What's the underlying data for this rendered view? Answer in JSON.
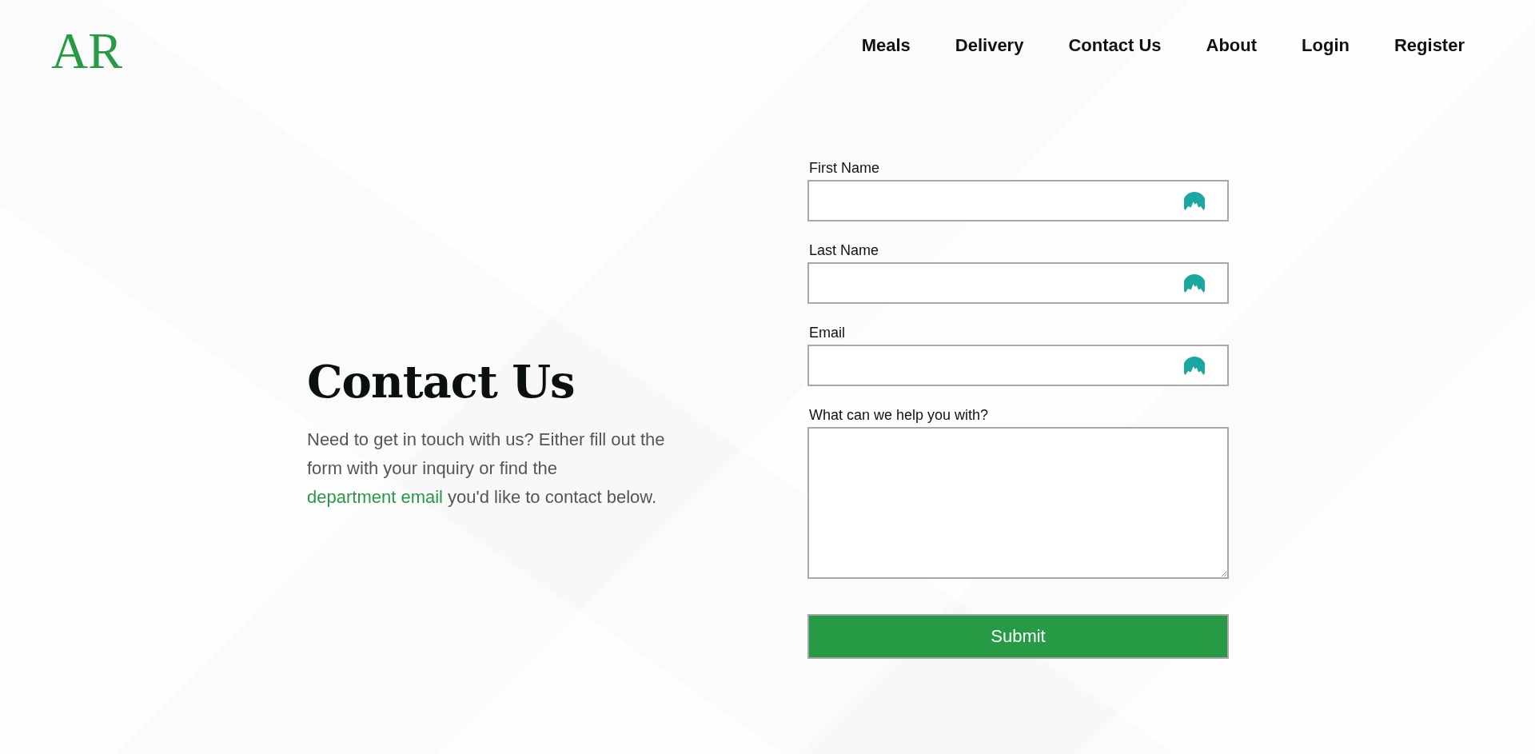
{
  "header": {
    "logo": "AR",
    "nav": [
      {
        "label": "Meals"
      },
      {
        "label": "Delivery"
      },
      {
        "label": "Contact Us"
      },
      {
        "label": "About"
      },
      {
        "label": "Login"
      },
      {
        "label": "Register"
      }
    ]
  },
  "hero": {
    "title": "Contact Us",
    "text_before": "Need to get in touch with us? Either fill out the form with your inquiry or find the ",
    "link": "department email",
    "text_after": " you'd like to contact below."
  },
  "form": {
    "fields": [
      {
        "kind": "input",
        "label": "First Name"
      },
      {
        "kind": "input",
        "label": "Last Name"
      },
      {
        "kind": "input",
        "label": "Email"
      },
      {
        "kind": "textarea",
        "label": "What can we help you with?"
      }
    ],
    "submit": "Submit"
  }
}
